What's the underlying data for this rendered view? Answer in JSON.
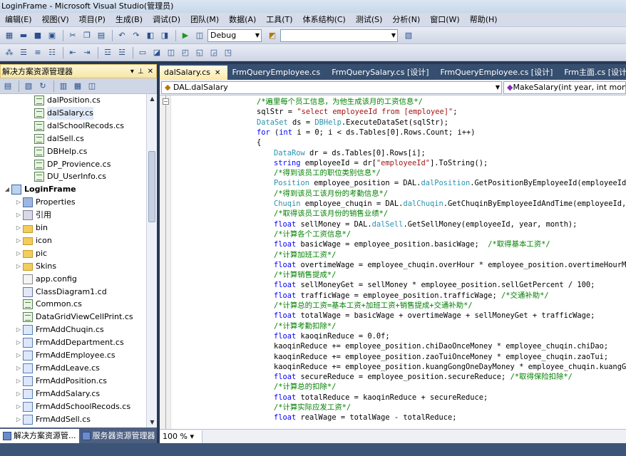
{
  "window": {
    "title": "LoginFrame - Microsoft Visual Studio(管理员)"
  },
  "menu": [
    "编辑(E)",
    "视图(V)",
    "项目(P)",
    "生成(B)",
    "调试(D)",
    "团队(M)",
    "数据(A)",
    "工具(T)",
    "体系结构(C)",
    "测试(S)",
    "分析(N)",
    "窗口(W)",
    "帮助(H)"
  ],
  "toolbar": {
    "config": "Debug",
    "search": ""
  },
  "solution_explorer": {
    "title": "解决方案资源管理器",
    "items": [
      {
        "label": "dalPosition.cs",
        "icon": "cs-file-icon"
      },
      {
        "label": "dalSalary.cs",
        "icon": "cs-file-icon"
      },
      {
        "label": "dalSchoolRecods.cs",
        "icon": "cs-file-icon"
      },
      {
        "label": "dalSell.cs",
        "icon": "cs-file-icon"
      },
      {
        "label": "DBHelp.cs",
        "icon": "cs-file-icon"
      },
      {
        "label": "DP_Provience.cs",
        "icon": "cs-file-icon"
      },
      {
        "label": "DU_UserInfo.cs",
        "icon": "cs-file-icon"
      },
      {
        "label": "LoginFrame",
        "icon": "project-icon"
      },
      {
        "label": "Properties",
        "icon": "properties-icon"
      },
      {
        "label": "引用",
        "icon": "references-icon"
      },
      {
        "label": "bin",
        "icon": "folder-icon"
      },
      {
        "label": "icon",
        "icon": "folder-icon"
      },
      {
        "label": "pic",
        "icon": "folder-icon"
      },
      {
        "label": "Skins",
        "icon": "folder-icon"
      },
      {
        "label": "app.config",
        "icon": "config-icon"
      },
      {
        "label": "ClassDiagram1.cd",
        "icon": "class-diagram-icon"
      },
      {
        "label": "Common.cs",
        "icon": "cs-file-icon"
      },
      {
        "label": "DataGridViewCellPrint.cs",
        "icon": "cs-file-icon"
      },
      {
        "label": "FrmAddChuqin.cs",
        "icon": "form-icon"
      },
      {
        "label": "FrmAddDepartment.cs",
        "icon": "form-icon"
      },
      {
        "label": "FrmAddEmployee.cs",
        "icon": "form-icon"
      },
      {
        "label": "FrmAddLeave.cs",
        "icon": "form-icon"
      },
      {
        "label": "FrmAddPosition.cs",
        "icon": "form-icon"
      },
      {
        "label": "FrmAddSalary.cs",
        "icon": "form-icon"
      },
      {
        "label": "FrmAddSchoolRecods.cs",
        "icon": "form-icon"
      },
      {
        "label": "FrmAddSell.cs",
        "icon": "form-icon"
      }
    ]
  },
  "bottom_tabs": [
    "解决方案资源管...",
    "服务器资源管理器"
  ],
  "doc_tabs": [
    "dalSalary.cs",
    "FrmQueryEmployee.cs",
    "FrmQuerySalary.cs [设计]",
    "FrmQueryEmployee.cs [设计]",
    "Frm主面.cs [设计]"
  ],
  "nav": {
    "class": "DAL.dalSalary",
    "member": "MakeSalary(int year, int month)"
  },
  "zoom": "100 %",
  "code": [
    [
      [
        "cm",
        "/*遍里每个员工信息，为他生成该月的工资信息*/"
      ]
    ],
    [
      [
        "",
        "sqlStr = "
      ],
      [
        "st",
        "\"select employeeId from [employee]\""
      ],
      [
        "",
        ";"
      ]
    ],
    [
      [
        "ty",
        "DataSet"
      ],
      [
        "",
        " ds = "
      ],
      [
        "ty",
        "DBHelp"
      ],
      [
        "",
        ".ExecuteDataSet(sqlStr);"
      ]
    ],
    [
      [
        "kw",
        "for"
      ],
      [
        "",
        " ("
      ],
      [
        "kw",
        "int"
      ],
      [
        "",
        " i = 0; i < ds.Tables[0].Rows.Count; i++)"
      ]
    ],
    [
      [
        "",
        "{"
      ]
    ],
    [
      [
        "ty",
        "DataRow"
      ],
      [
        "",
        " dr = ds.Tables[0].Rows[i];"
      ]
    ],
    [
      [
        "kw",
        "string"
      ],
      [
        "",
        " employeeId = dr["
      ],
      [
        "st",
        "\"employeeId\""
      ],
      [
        "",
        "].ToString();"
      ]
    ],
    [
      [
        "cm",
        "/*得到该员工的职位类别信息*/"
      ]
    ],
    [
      [
        "ty",
        "Position"
      ],
      [
        "",
        " employee_position = DAL."
      ],
      [
        "ty",
        "dalPosition"
      ],
      [
        "",
        ".GetPositionByEmployeeId(employeeId);"
      ]
    ],
    [
      [
        "cm",
        "/*得到该员工该月份的考勤信息*/"
      ]
    ],
    [
      [
        "ty",
        "Chuqin"
      ],
      [
        "",
        " employee_chuqin = DAL."
      ],
      [
        "ty",
        "dalChuqin"
      ],
      [
        "",
        ".GetChuqinByEmployeeIdAndTime(employeeId, year, month);"
      ]
    ],
    [
      [
        "cm",
        "/*取得该员工该月份的销售业绩*/"
      ]
    ],
    [
      [
        "kw",
        "float"
      ],
      [
        "",
        " sellMoney = DAL."
      ],
      [
        "ty",
        "dalSell"
      ],
      [
        "",
        ".GetSellMoney(employeeId, year, month);"
      ]
    ],
    [
      [
        "cm",
        "/*计算各个工资信息*/"
      ]
    ],
    [
      [
        "kw",
        "float"
      ],
      [
        "",
        " basicWage = employee_position.basicWage;  "
      ],
      [
        "cm",
        "/*取得基本工资*/"
      ]
    ],
    [
      [
        "cm",
        "/*计算加班工资*/"
      ]
    ],
    [
      [
        "kw",
        "float"
      ],
      [
        "",
        " overtimeWage = employee_chuqin.overHour * employee_position.overtimeHourMoney;"
      ]
    ],
    [
      [
        "cm",
        "/*计算销售提成*/"
      ]
    ],
    [
      [
        "kw",
        "float"
      ],
      [
        "",
        " sellMoneyGet = sellMoney * employee_position.sellGetPercent / 100;"
      ]
    ],
    [
      [
        "kw",
        "float"
      ],
      [
        "",
        " trafficWage = employee_position.trafficWage; "
      ],
      [
        "cm",
        "/*交通补助*/"
      ]
    ],
    [
      [
        "cm",
        "/*计算总的工资=基本工资+加班工资+销售提成+交通补助*/"
      ]
    ],
    [
      [
        "kw",
        "float"
      ],
      [
        "",
        " totalWage = basicWage + overtimeWage + sellMoneyGet + trafficWage;"
      ]
    ],
    [
      [
        "cm",
        "/*计算考勤扣除*/"
      ]
    ],
    [
      [
        "kw",
        "float"
      ],
      [
        "",
        " kaoqinReduce = 0.0f;"
      ]
    ],
    [
      [
        "",
        "kaoqinReduce += employee_position.chiDaoOnceMoney * employee_chuqin.chiDao;"
      ]
    ],
    [
      [
        "",
        "kaoqinReduce += employee_position.zaoTuiOnceMoney * employee_chuqin.zaoTui;"
      ]
    ],
    [
      [
        "",
        "kaoqinReduce += employee_position.kuangGongOneDayMoney * employee_chuqin.kuangGong;"
      ]
    ],
    [
      [
        "kw",
        "float"
      ],
      [
        "",
        " secureReduce = employee_position.secureReduce; "
      ],
      [
        "cm",
        "/*取得保险扣除*/"
      ]
    ],
    [
      [
        "cm",
        "/*计算总的扣除*/"
      ]
    ],
    [
      [
        "kw",
        "float"
      ],
      [
        "",
        " totalReduce = kaoqinReduce + secureReduce;"
      ]
    ],
    [
      [
        "cm",
        "/*计算实际应发工资*/"
      ]
    ],
    [
      [
        "kw",
        "float"
      ],
      [
        "",
        " realWage = totalWage - totalReduce;"
      ]
    ]
  ]
}
